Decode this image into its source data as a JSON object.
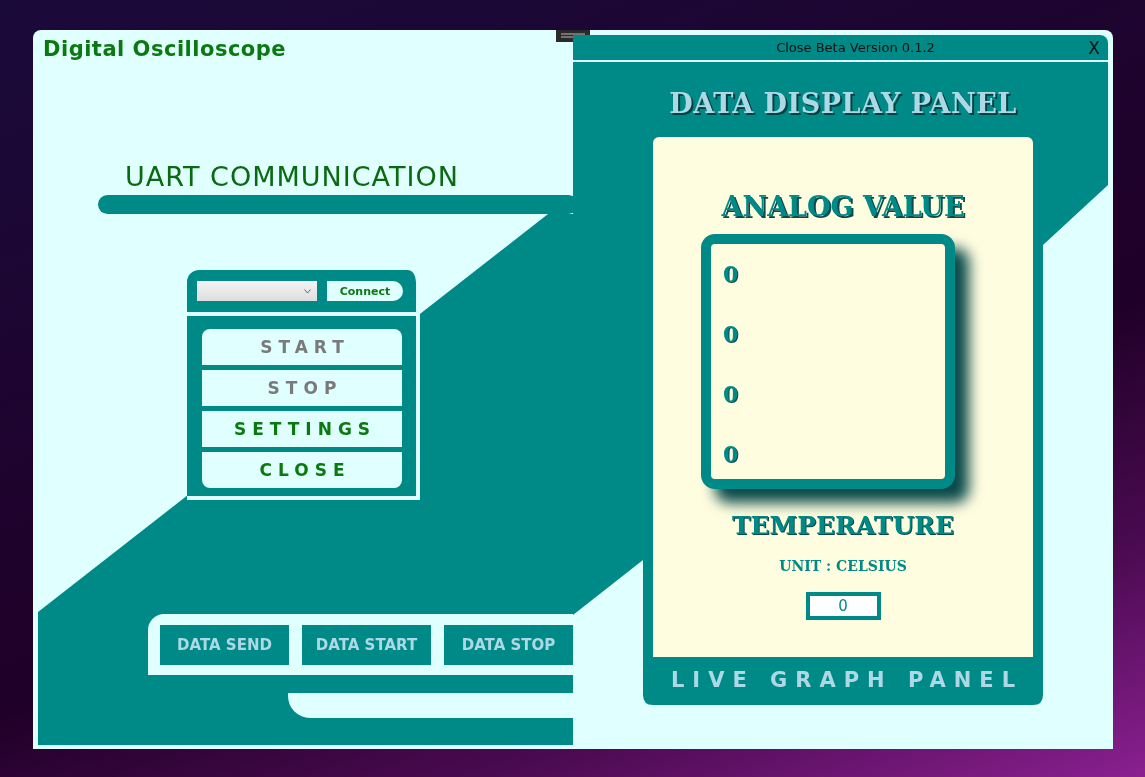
{
  "app_title": "Digital Oscilloscope",
  "section_title": "UART COMMUNICATION",
  "connect_button": "Connect",
  "control_buttons": [
    {
      "label": "START",
      "disabled": true
    },
    {
      "label": "STOP",
      "disabled": true
    },
    {
      "label": "SETTINGS",
      "disabled": false
    },
    {
      "label": "CLOSE",
      "disabled": false
    }
  ],
  "data_buttons": [
    "DATA SEND",
    "DATA START",
    "DATA STOP"
  ],
  "title_bar": {
    "title": "Close Beta Version 0.1.2",
    "close": "X"
  },
  "display_panel": {
    "title": "DATA DISPLAY PANEL",
    "analog_title": "ANALOG VALUE",
    "analog_values": [
      "0",
      "0",
      "0",
      "0"
    ],
    "temperature_title": "TEMPERATURE",
    "unit": "UNIT : CELSIUS",
    "temperature_value": "0",
    "footer": "LIVE GRAPH PANEL"
  }
}
